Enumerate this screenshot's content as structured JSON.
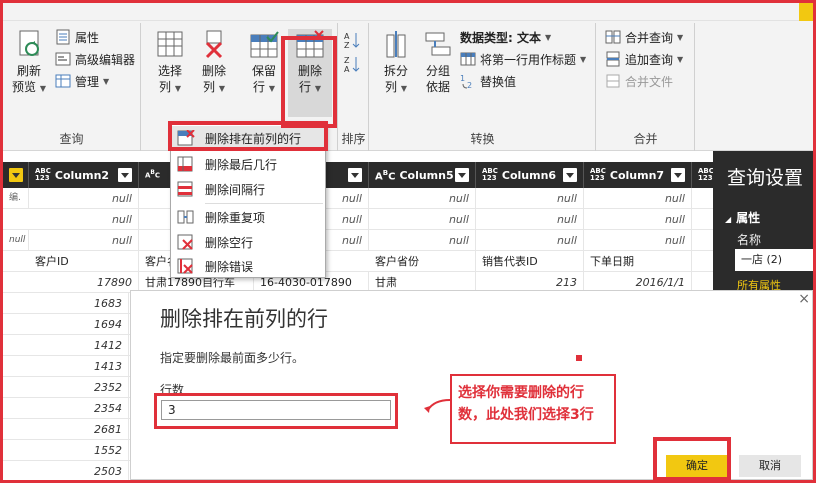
{
  "ribbon": {
    "groups": {
      "query": "查询",
      "sort": "排序",
      "transform": "转换",
      "combine": "合并"
    },
    "refresh": [
      "刷新",
      "预览"
    ],
    "properties": "属性",
    "advanced_editor": "高级编辑器",
    "manage": "管理",
    "choose_columns": [
      "选择",
      "列"
    ],
    "remove_columns": [
      "删除",
      "列"
    ],
    "keep_rows": [
      "保留",
      "行"
    ],
    "remove_rows": [
      "删除",
      "行"
    ],
    "split_column": [
      "拆分",
      "列"
    ],
    "group_by": [
      "分组",
      "依据"
    ],
    "data_type": "数据类型: 文本",
    "first_row_header": "将第一行用作标题",
    "replace_values": "替换值",
    "merge_queries": "合并查询",
    "append_queries": "追加查询",
    "combine_files": "合并文件"
  },
  "menu": {
    "items": [
      "删除排在前列的行",
      "删除最后几行",
      "删除间隔行",
      "删除重复项",
      "删除空行",
      "删除错误"
    ]
  },
  "grid": {
    "columns": [
      {
        "type": "ABC\n123",
        "name": "Column2"
      },
      {
        "type": "ABC\n123",
        "name": ""
      },
      {
        "type": "ABC\n123",
        "name": ""
      },
      {
        "type": "A B C",
        "name": "Column5"
      },
      {
        "type": "ABC\n123",
        "name": "Column6"
      },
      {
        "type": "ABC\n123",
        "name": "Column7"
      },
      {
        "type": "ABC\n123",
        "name": ""
      }
    ],
    "null_text": "null",
    "left_frag": [
      "编.",
      "",
      "null"
    ],
    "header_row": [
      "客户ID",
      "客户名",
      "",
      "客户省份",
      "销售代表ID",
      "下单日期"
    ],
    "first_data": [
      "17890",
      "甘肃17890自行车",
      "16-4030-017890",
      "甘肃",
      "213",
      "2016/1/1"
    ],
    "ids": [
      "1683",
      "1694",
      "1412",
      "1413",
      "2352",
      "2354",
      "2681",
      "1552",
      "2503"
    ]
  },
  "pane": {
    "title": "查询设置",
    "section": "属性",
    "name_label": "名称",
    "name_value": "一店 (2)",
    "all_props": "所有属性"
  },
  "dialog": {
    "title": "删除排在前列的行",
    "description": "指定要删除最前面多少行。",
    "rows_label": "行数",
    "rows_value": "3",
    "ok": "确定",
    "cancel": "取消",
    "close": "×"
  },
  "callout": {
    "line1": "选择你需要删除的行",
    "line2": "数，此处我们选择3行"
  },
  "colors": {
    "accent": "#f2c811",
    "annotation": "#e0303a",
    "grid_header": "#2b2b2b"
  }
}
